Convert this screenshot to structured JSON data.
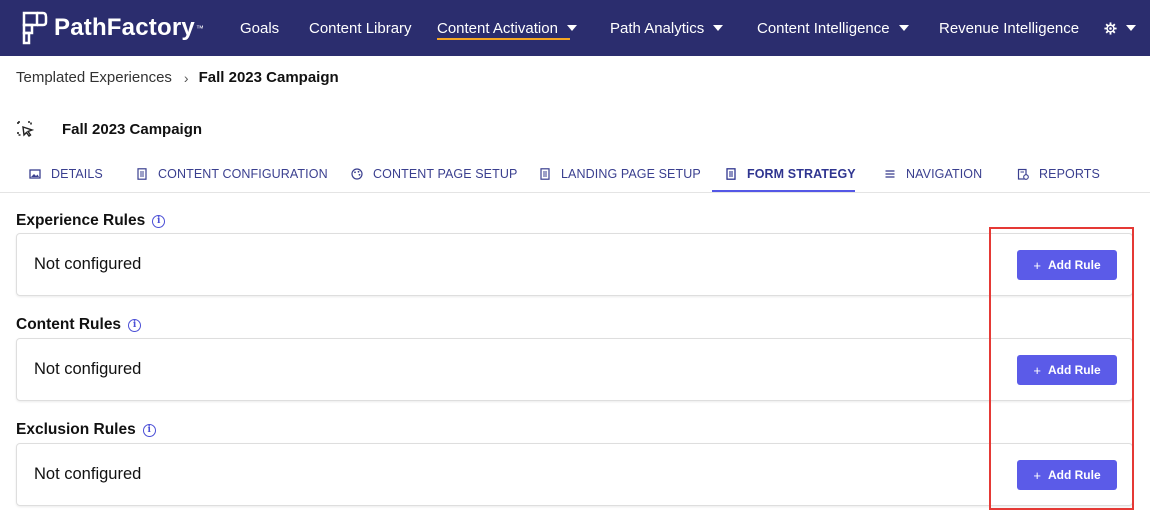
{
  "topbar": {
    "logo_text": "PathFactory",
    "logo_mark": "™",
    "nav": [
      {
        "label": "Goals",
        "dropdown": false
      },
      {
        "label": "Content Library",
        "dropdown": false
      },
      {
        "label": "Content Activation",
        "dropdown": true,
        "active": true
      },
      {
        "label": "Path Analytics",
        "dropdown": true
      },
      {
        "label": "Content Intelligence",
        "dropdown": true
      },
      {
        "label": "Revenue Intelligence",
        "dropdown": false
      }
    ],
    "settings_icon": "gear-icon",
    "colors": {
      "background": "#2b2d6e",
      "active_underline": "#f5a623"
    }
  },
  "breadcrumb": {
    "parent": "Templated Experiences",
    "current": "Fall 2023 Campaign"
  },
  "page": {
    "title": "Fall 2023 Campaign",
    "title_icon": "cursor-select-icon"
  },
  "tabs": [
    {
      "label": "DETAILS",
      "icon": "image-icon"
    },
    {
      "label": "CONTENT CONFIGURATION",
      "icon": "document-icon"
    },
    {
      "label": "CONTENT PAGE SETUP",
      "icon": "palette-icon"
    },
    {
      "label": "LANDING PAGE SETUP",
      "icon": "document-icon"
    },
    {
      "label": "FORM STRATEGY",
      "icon": "document-icon",
      "active": true
    },
    {
      "label": "NAVIGATION",
      "icon": "menu-icon"
    },
    {
      "label": "REPORTS",
      "icon": "report-icon"
    }
  ],
  "sections": [
    {
      "title": "Experience Rules",
      "status": "Not configured",
      "button": "Add Rule"
    },
    {
      "title": "Content Rules",
      "status": "Not configured",
      "button": "Add Rule"
    },
    {
      "title": "Exclusion Rules",
      "status": "Not configured",
      "button": "Add Rule"
    }
  ],
  "accent_color": "#5b5be8",
  "highlight_color": "#e53935"
}
